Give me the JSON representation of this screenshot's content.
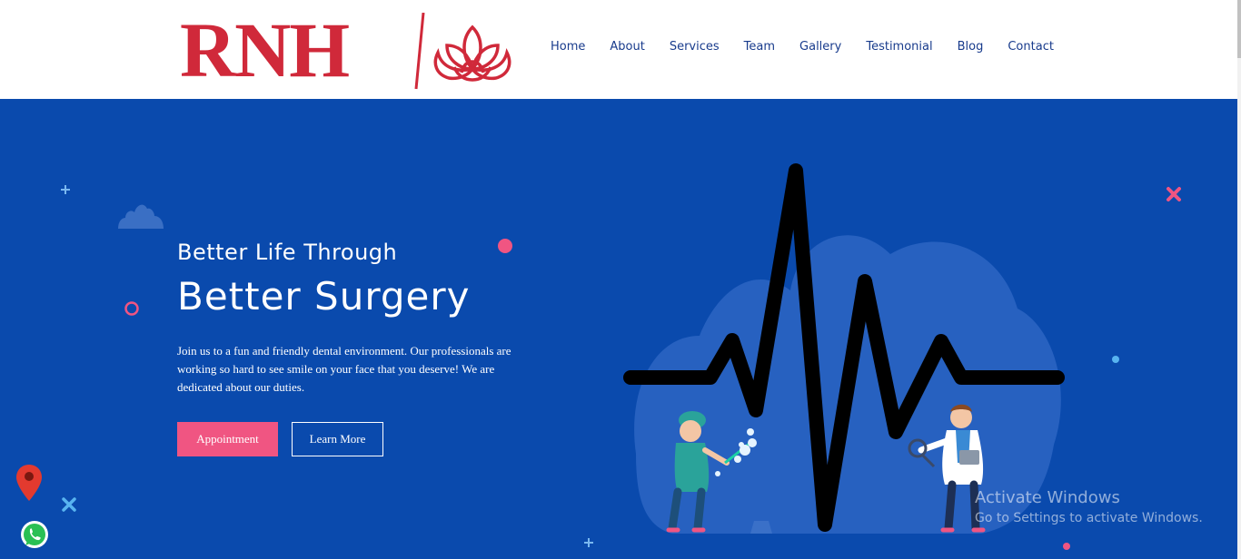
{
  "header": {
    "logo_text": "RNH",
    "nav": [
      "Home",
      "About",
      "Services",
      "Team",
      "Gallery",
      "Testimonial",
      "Blog",
      "Contact"
    ]
  },
  "hero": {
    "title_line1": "Better Life Through",
    "title_line2": "Better Surgery",
    "description": "Join us to a fun and friendly dental environment. Our professionals are working so hard to see smile on your face that you deserve! We are dedicated about our duties.",
    "primary_button": "Appointment",
    "secondary_button": "Learn More"
  },
  "watermark": {
    "title": "Activate Windows",
    "subtitle": "Go to Settings to activate Windows."
  },
  "colors": {
    "brand_red": "#d0293a",
    "hero_blue": "#0a4aad",
    "accent_pink": "#f05582",
    "nav_text": "#183b8c"
  },
  "icons": {
    "location": "map-pin-icon",
    "chat": "whatsapp-icon",
    "logo_mark": "lotus-icon"
  }
}
